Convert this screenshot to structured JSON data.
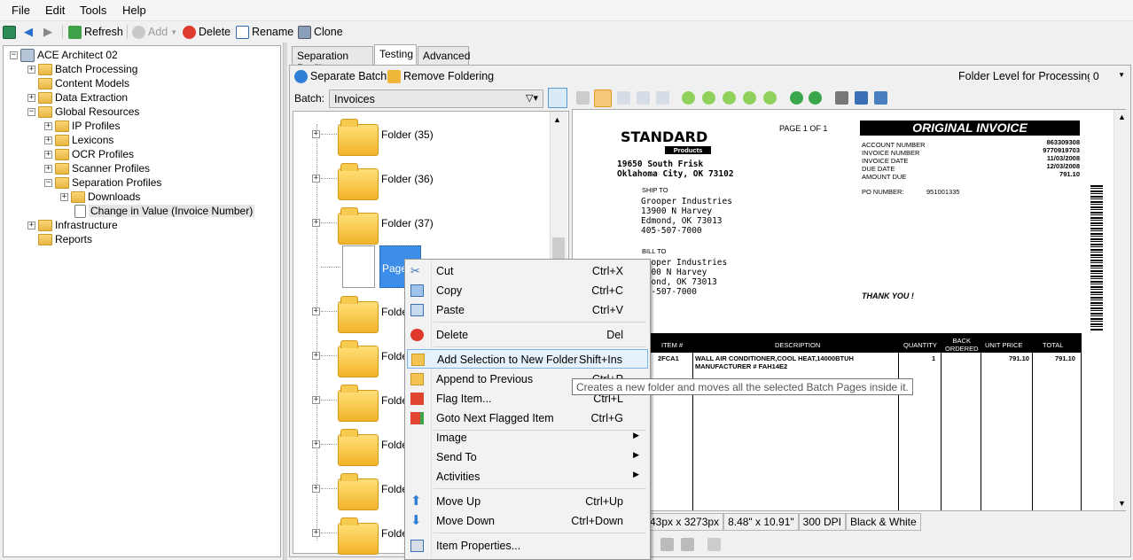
{
  "menu": {
    "items": [
      "File",
      "Edit",
      "Tools",
      "Help"
    ]
  },
  "toolbar": {
    "refresh": "Refresh",
    "add": "Add",
    "delete": "Delete",
    "rename": "Rename",
    "clone": "Clone"
  },
  "tree": {
    "root": "ACE Architect 02",
    "items": [
      "Batch Processing",
      "Content Models",
      "Data Extraction",
      "Global Resources",
      "IP Profiles",
      "Lexicons",
      "OCR Profiles",
      "Scanner Profiles",
      "Separation Profiles",
      "Downloads",
      "Change in Value (Invoice Number)",
      "Infrastructure",
      "Reports"
    ]
  },
  "tabs": [
    "Separation Profile",
    "Testing",
    "Advanced"
  ],
  "testing": {
    "separate_batch": "Separate Batch",
    "remove_foldering": "Remove Foldering",
    "folder_level_label": "Folder Level for Processing:",
    "folder_level_value": "0",
    "batch_label": "Batch:",
    "batch_value": "Invoices"
  },
  "batch_tree": {
    "folders": [
      "Folder (35)",
      "Folder (36)",
      "Folder (37)",
      "Folde",
      "Folde",
      "Folde",
      "Folde",
      "Folde",
      "Folde"
    ],
    "page_label": "Page"
  },
  "context_menu": {
    "items": [
      {
        "label": "Cut",
        "shortcut": "Ctrl+X"
      },
      {
        "label": "Copy",
        "shortcut": "Ctrl+C"
      },
      {
        "label": "Paste",
        "shortcut": "Ctrl+V"
      },
      {
        "label": "Delete",
        "shortcut": "Del"
      },
      {
        "label": "Add Selection to New Folder",
        "shortcut": "Shift+Ins"
      },
      {
        "label": "Append to Previous",
        "shortcut": "Ctrl+P"
      },
      {
        "label": "Flag Item...",
        "shortcut": "Ctrl+L"
      },
      {
        "label": "Goto Next Flagged Item",
        "shortcut": "Ctrl+G"
      },
      {
        "label": "Image",
        "shortcut": ""
      },
      {
        "label": "Send To",
        "shortcut": ""
      },
      {
        "label": "Activities",
        "shortcut": ""
      },
      {
        "label": "Move Up",
        "shortcut": "Ctrl+Up"
      },
      {
        "label": "Move Down",
        "shortcut": "Ctrl+Down"
      },
      {
        "label": "Item Properties...",
        "shortcut": ""
      }
    ]
  },
  "tooltip": "Creates a new folder and moves all the selected Batch Pages inside it.",
  "status": {
    "size": "43px x 3273px",
    "dims": "8.48\" x 10.91\"",
    "dpi": "300 DPI",
    "color": "Black & White"
  },
  "invoice": {
    "brand": "STANDARD",
    "brand_sub": "Products",
    "address": "19650 South Frisk\nOklahoma City, OK 73102",
    "page": "PAGE 1 OF 1",
    "title": "ORIGINAL INVOICE",
    "fields_left": "ACCOUNT NUMBER\nINVOICE NUMBER\nINVOICE DATE\nDUE DATE\nAMOUNT DUE",
    "fields_right": "863309308\n9770919703\n11/03/2008\n12/03/2008\n791.10",
    "po_label": "PO NUMBER:",
    "po_value": "951001335",
    "ship_to_label": "SHIP TO",
    "ship_to": "Grooper Industries\n13900 N Harvey\nEdmond, OK 73013\n405-507-7000",
    "bill_to_label": "BILL TO",
    "bill_to": "rooper Industries\n3900 N Harvey\ndmond, OK 73013\n05-507-7000",
    "thank_you": "THANK YOU !",
    "col_item": "ITEM #",
    "col_desc": "DESCRIPTION",
    "col_qty": "QUANTITY",
    "col_back": "BACK\nORDERED",
    "col_unit": "UNIT PRICE",
    "col_total": "TOTAL",
    "row_item": "2FCA1",
    "row_desc": "WALL AIR CONDITIONER,COOL HEAT,14000BTUH\nMANUFACTURER # FAH14E2",
    "row_qty": "1",
    "row_unit": "791.10",
    "row_total": "791.10"
  }
}
